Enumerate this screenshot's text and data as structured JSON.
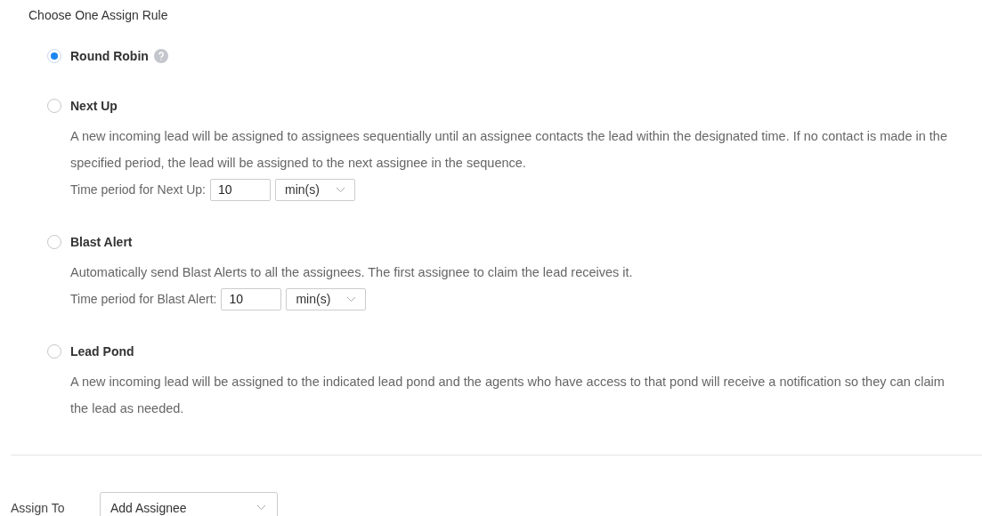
{
  "heading": "Choose One Assign Rule",
  "rules": [
    {
      "label": "Round Robin",
      "selected": true,
      "help": true
    },
    {
      "label": "Next Up",
      "selected": false,
      "help": false,
      "description": "A new incoming lead will be assigned to assignees sequentially until an assignee contacts the lead within the designated time. If no contact is made in the specified period, the lead will be assigned to the next assignee in the sequence.",
      "time_period": {
        "label": "Time period for Next Up:",
        "value": "10",
        "unit": "min(s)"
      }
    },
    {
      "label": "Blast Alert",
      "selected": false,
      "help": false,
      "description": "Automatically send Blast Alerts to all the assignees. The first assignee to claim the lead receives it.",
      "time_period": {
        "label": "Time period for Blast Alert:",
        "value": "10",
        "unit": "min(s)"
      }
    },
    {
      "label": "Lead Pond",
      "selected": false,
      "help": false,
      "description": "A new incoming lead will be assigned to the indicated lead pond and the agents who have access to that pond will receive a notification so they can claim the lead as needed."
    }
  ],
  "assign_to": {
    "label": "Assign To",
    "value": "Add Assignee"
  }
}
